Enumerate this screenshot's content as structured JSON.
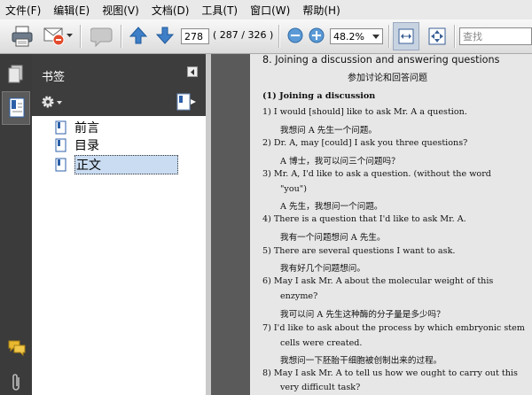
{
  "menu": [
    "文件(F)",
    "编辑(E)",
    "视图(V)",
    "文档(D)",
    "工具(T)",
    "窗口(W)",
    "帮助(H)"
  ],
  "toolbar": {
    "page_number": "278",
    "page_total": "( 287 / 326 )",
    "zoom": "48.2%",
    "search_placeholder": "查找"
  },
  "bookmarks": {
    "title": "书签",
    "items": [
      {
        "label": "前言",
        "selected": false
      },
      {
        "label": "目录",
        "selected": false
      },
      {
        "label": "正文",
        "selected": true
      }
    ]
  },
  "document": {
    "heading_en": "8. Joining a discussion and answering questions",
    "heading_zh": "参加讨论和回答问题",
    "lines": [
      "(1) Joining a discussion",
      "1)  I would [should] like to ask Mr. A a question.",
      "我想问 A 先生一个问题。",
      "2)  Dr. A, may [could] I ask you three questions?",
      "A 博士，我可以问三个问题吗？",
      "3)  Mr. A, I'd like to ask a question. (without the word",
      "\"you\")",
      "A 先生，我想问一个问题。",
      "4)  There is a question that I'd like to ask Mr. A.",
      "我有一个问题想问 A 先生。",
      "5)  There are several questions I want to ask.",
      "我有好几个问题想问。",
      "6)  May I ask Mr. A about the molecular weight of this",
      "enzyme?",
      "我可以问 A 先生这种酶的分子量是多少吗？",
      "7)  I'd like to ask about the process by which embryonic stem",
      "cells were created.",
      "我想问一下胚胎干细胞被创制出来的过程。",
      "8)  May I ask Mr. A to tell us how we ought to carry out this",
      "very difficult task?"
    ]
  },
  "colors": {
    "menubar_bg": "#e9e9e9",
    "toolbar_bg": "#dcdcdc",
    "panel_dark": "#3d3d3d",
    "doc_bg": "#5a5a5a",
    "page_bg": "#e7e7e7",
    "selection": "#c9dcf2",
    "nav_blue": "#3f7fc8"
  },
  "icons": {
    "print": "printer-icon",
    "email": "email-icon",
    "comment": "comment-icon",
    "prev": "up-arrow-icon",
    "next": "down-arrow-icon"
  }
}
